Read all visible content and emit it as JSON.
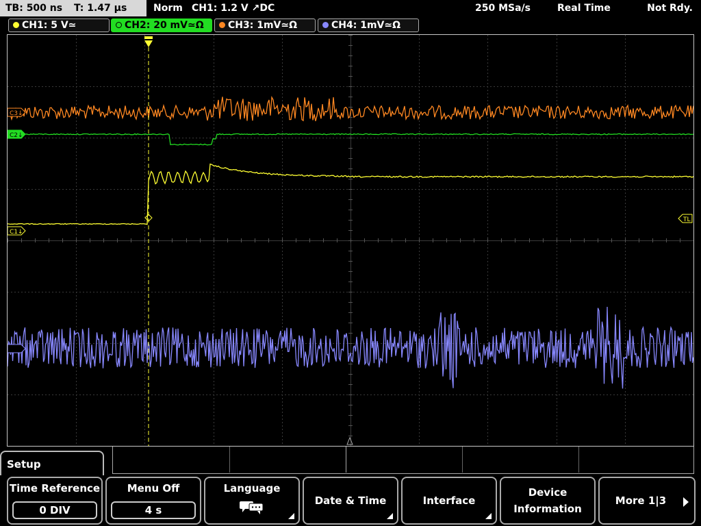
{
  "status": {
    "timebase": "TB: 500 ns",
    "trigger_time": "T: 1.47 µs",
    "trigger_mode": "Norm",
    "trigger_info": "CH1: 1.2 V ↗DC",
    "sample_rate": "250 MSa/s",
    "acquisition": "Real Time",
    "state": "Not Rdy."
  },
  "channels": [
    {
      "id": "ch1",
      "label": "CH1: 5 V≃",
      "color": "#ffff33",
      "marker": "C1↓"
    },
    {
      "id": "ch2",
      "label": "CH2: 20 mV≃Ω",
      "color": "#22dd22",
      "marker": "C2↓",
      "active": true
    },
    {
      "id": "ch3",
      "label": "CH3: 1mV≃Ω",
      "color": "#ff8822",
      "marker": "C3↓"
    },
    {
      "id": "ch4",
      "label": "CH4: 1mV≃Ω",
      "color": "#8888ff",
      "marker": "C4↓"
    }
  ],
  "markers": {
    "trigger_level": "TL"
  },
  "menu": {
    "title": "Setup",
    "time_reference": {
      "label": "Time Reference",
      "value": "0 DIV"
    },
    "menu_off": {
      "label": "Menu Off",
      "value": "4 s"
    },
    "language": {
      "label": "Language",
      "icon": "speech-bubbles-icon"
    },
    "date_time": {
      "label": "Date & Time"
    },
    "interface": {
      "label": "Interface"
    },
    "device_info": {
      "line1": "Device",
      "line2": "Information"
    },
    "more": {
      "label": "More 1|3"
    }
  }
}
